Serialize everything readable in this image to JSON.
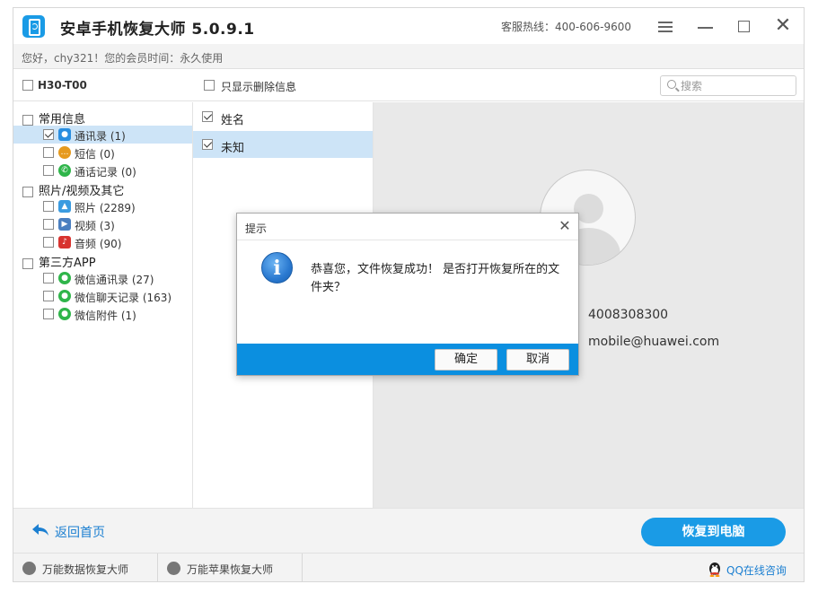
{
  "app": {
    "title": "安卓手机恢复大师 5.0.9.1",
    "hotline": "客服热线：400-606-9600",
    "member_info": "您好，chy321！您的会员时间：永久使用"
  },
  "toolbar": {
    "device": "H30-T00",
    "show_deleted": "只显示删除信息",
    "search_placeholder": "搜索"
  },
  "tree": {
    "groups": [
      {
        "label": "常用信息",
        "items": [
          {
            "label": "通讯录 (1)",
            "icon": "contacts-icon",
            "color": "#2a8ee0",
            "checked": true,
            "selected": true
          },
          {
            "label": "短信 (0)",
            "icon": "sms-icon",
            "color": "#e69a1e",
            "checked": false,
            "selected": false
          },
          {
            "label": "通话记录 (0)",
            "icon": "call-log-icon",
            "color": "#2fb54a",
            "checked": false,
            "selected": false
          }
        ]
      },
      {
        "label": "照片/视频及其它",
        "items": [
          {
            "label": "照片 (2289)",
            "icon": "photo-icon",
            "color": "#3a9be0",
            "checked": false,
            "selected": false
          },
          {
            "label": "视频 (3)",
            "icon": "video-icon",
            "color": "#4a7fc0",
            "checked": false,
            "selected": false
          },
          {
            "label": "音频 (90)",
            "icon": "audio-icon",
            "color": "#d8332f",
            "checked": false,
            "selected": false
          }
        ]
      },
      {
        "label": "第三方APP",
        "items": [
          {
            "label": "微信通讯录 (27)",
            "icon": "wechat-icon",
            "color": "#2fb54a",
            "checked": false,
            "selected": false
          },
          {
            "label": "微信聊天记录 (163)",
            "icon": "wechat-icon",
            "color": "#2fb54a",
            "checked": false,
            "selected": false
          },
          {
            "label": "微信附件 (1)",
            "icon": "wechat-icon",
            "color": "#2fb54a",
            "checked": false,
            "selected": false
          }
        ]
      }
    ]
  },
  "list": {
    "header": "姓名",
    "rows": [
      {
        "label": "未知",
        "checked": true,
        "selected": true
      }
    ]
  },
  "detail": {
    "phone": "4008308300",
    "email": "mobile@huawei.com"
  },
  "bottom": {
    "back_label": "返回首页",
    "recover_label": "恢复到电脑"
  },
  "footer": {
    "tab1": "万能数据恢复大师",
    "tab2": "万能苹果恢复大师",
    "qq": "QQ在线咨询"
  },
  "dialog": {
    "title": "提示",
    "message": "恭喜您，文件恢复成功！ 是否打开恢复所在的文件夹？",
    "ok": "确定",
    "cancel": "取消"
  },
  "colors": {
    "accent": "#1a9be6",
    "selected_row": "#cde4f7",
    "link": "#1b7fd1"
  }
}
